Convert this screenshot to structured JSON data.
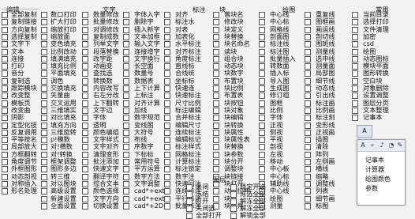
{
  "columns": [
    {
      "header": "编辑",
      "rows": [
        "全部复制",
        "复制链接",
        "方向复制",
        "选择复制",
        "文字下",
        "文本",
        "连接",
        "打印",
        "音分",
        "复制选",
        "跟踪模块",
        "改变整",
        "模板页",
        "改变曲",
        "阴影",
        "定型化技",
        "反复调用",
        "平等按名",
        "局部放大",
        "方框翻转",
        "角度调节",
        "外框图形",
        "动态剖视",
        "对称插入",
        "形名处理"
      ]
    },
    {
      "header": "",
      "rows": [
        "数口打印",
        "扩大打印",
        "缩放打印",
        "缩放面",
        "变色填充",
        "比例改动",
        "填满填充",
        "填充比例",
        "平面填充",
        "调色",
        "交换填充",
        "矢量曲",
        "交叉运用",
        "三维填实",
        "对比填充",
        "填充方向",
        "三维旋转",
        "p!模数",
        "对!横数",
        "对!转换",
        "框架调整",
        "图形多边",
        "转三维",
        "对以图块",
        "高级设置",
        "新建设置",
        "全面设置"
      ]
    },
    {
      "header": "文字",
      "rows": [
        "数量修改",
        "批量修改",
        "对调修改",
        "复制成数",
        "列举文字",
        "段落替换",
        "改字距",
        "动画变",
        "查找选",
        "转换数",
        "内容改写",
        "右左分改",
        "上下翻转",
        "文字边",
        "字体",
        "透明",
        "颜色编组",
        "文字样式",
        "文字对齐",
        "清理变形",
        "批注添加",
        "快速文字",
        "翻译字符",
        "综合文本",
        "颜色选择",
        "文字方向",
        "切换设置"
      ]
    },
    {
      "header": "",
      "rows": [
        "字体入字",
        "删除字",
        "插入新字",
        "文本加框",
        "输入文字",
        "连接增字",
        "文字换行",
        "长空面",
        "数量号",
        "数据表",
        "上下计算",
        "上标注",
        "对齐计算",
        "加线",
        "数字规范",
        "变线图",
        "大符号",
        "布线",
        "序数字",
        "下标标",
        "常用符号",
        "平方运算",
        "数字方法",
        "文字调整",
        "cad*+ext",
        "cad*+ext",
        "cad*+2D"
      ]
    },
    {
      "header": "标注",
      "rows": [
        "对齐",
        "标注水",
        "对表",
        "加表化",
        "水平标注",
        "对齐标注",
        "角度标注",
        "直线标",
        "合线统",
        "坐标标",
        "快速连",
        "快速标注",
        "尺寸比例",
        "标注编辑",
        "合并标注",
        "编辑尺寸",
        "连续标注",
        "编辑标记",
        "标注样式",
        "网格标注",
        "计算标注",
        "标注锁定",
        "数字注",
        "快速回注",
        "连续标注",
        "平行标注",
        "批量标注"
      ]
    },
    {
      "header": "块",
      "rows": [
        "普块名",
        "修改块",
        "块定义",
        "块替换",
        "块名命名",
        "读块",
        "组合块",
        "动态块",
        "块数字",
        "布置块",
        "块比例",
        "布置表",
        "块按钮",
        "块对象",
        "块编辑",
        "块转换",
        "块属性",
        "块属性表",
        "块替换",
        "块参数",
        "块分开",
        "调整块",
        "块链接",
        "块打开",
        "动态拉伸",
        "块组",
        "块合并"
      ]
    },
    {
      "header": "绘图",
      "rows": [
        "中心线",
        "中心标",
        "网格线",
        "剖面图",
        "标注线",
        "标注图",
        "批量插入",
        "转数面",
        "插入标",
        "导入图",
        "生成图",
        "修订组",
        "图框",
        "比例",
        "字体",
        "正视",
        "侧视",
        "平视",
        "剖视",
        "左视",
        "移动",
        "中心板",
        "中心标",
        "辅助线",
        "中心线",
        "绘图",
        "测量"
      ]
    },
    {
      "header": "",
      "rows": [
        "重复线",
        "图框画",
        "画运线",
        "剖切线",
        "图斑线",
        "测量线",
        "选中线",
        "测量面",
        "局部图",
        "细节线",
        "动态线",
        "引出线",
        "标注画",
        "比例画",
        "标注刻",
        "变形线",
        "正视画",
        "插图",
        "清除",
        "阵列",
        "左侧画",
        "横线",
        "缩略",
        "调整线",
        "列表",
        "细节画",
        "标图"
      ]
    },
    {
      "header": "常用",
      "rows": [
        "当前目录",
        "选择打印",
        "文件清理",
        "加密",
        "csd",
        "绘图",
        "动态图标",
        "模块平面",
        "图形转换",
        "空白块",
        "对象删除",
        "设置调整",
        "图层分页",
        "文本整理",
        "记事本",
        "计算器",
        "绘图颜色",
        "多功能"
      ]
    },
    {
      "header": "图层",
      "rows": [
        "关闭",
        "冻结",
        "打开",
        "关闭选",
        "全部打开"
      ]
    },
    {
      "header": "",
      "rows": [
        "锁定开选",
        "冻选全部",
        "解冻全部",
        "解冻全部",
        "解锁全部"
      ]
    }
  ],
  "floating": {
    "icons": [
      "A",
      "⌕",
      "♪",
      "◔",
      "✎"
    ],
    "items": [
      "记事本",
      "计算器",
      "绘图颜色",
      "参数"
    ],
    "tab_label": "A"
  }
}
